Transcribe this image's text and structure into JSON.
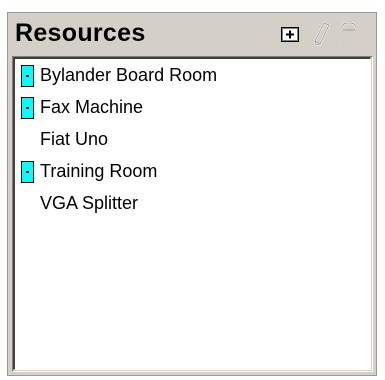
{
  "panel": {
    "title": "Resources",
    "toolbar": [
      {
        "name": "add-resource-button",
        "icon": "plus-box-icon",
        "enabled": true
      },
      {
        "name": "edit-resource-button",
        "icon": "pencil-icon",
        "enabled": false
      },
      {
        "name": "delete-resource-button",
        "icon": "trash-icon",
        "enabled": false
      }
    ]
  },
  "resources": [
    {
      "label": "Bylander Board Room",
      "has_icon": true
    },
    {
      "label": "Fax Machine",
      "has_icon": true
    },
    {
      "label": "Fiat Uno",
      "has_icon": false
    },
    {
      "label": "Training Room",
      "has_icon": true
    },
    {
      "label": "VGA Splitter",
      "has_icon": false
    }
  ],
  "colors": {
    "panel_bg": "#d4d0c8",
    "list_bg": "#ffffff",
    "resource_icon": "#00ffff"
  }
}
